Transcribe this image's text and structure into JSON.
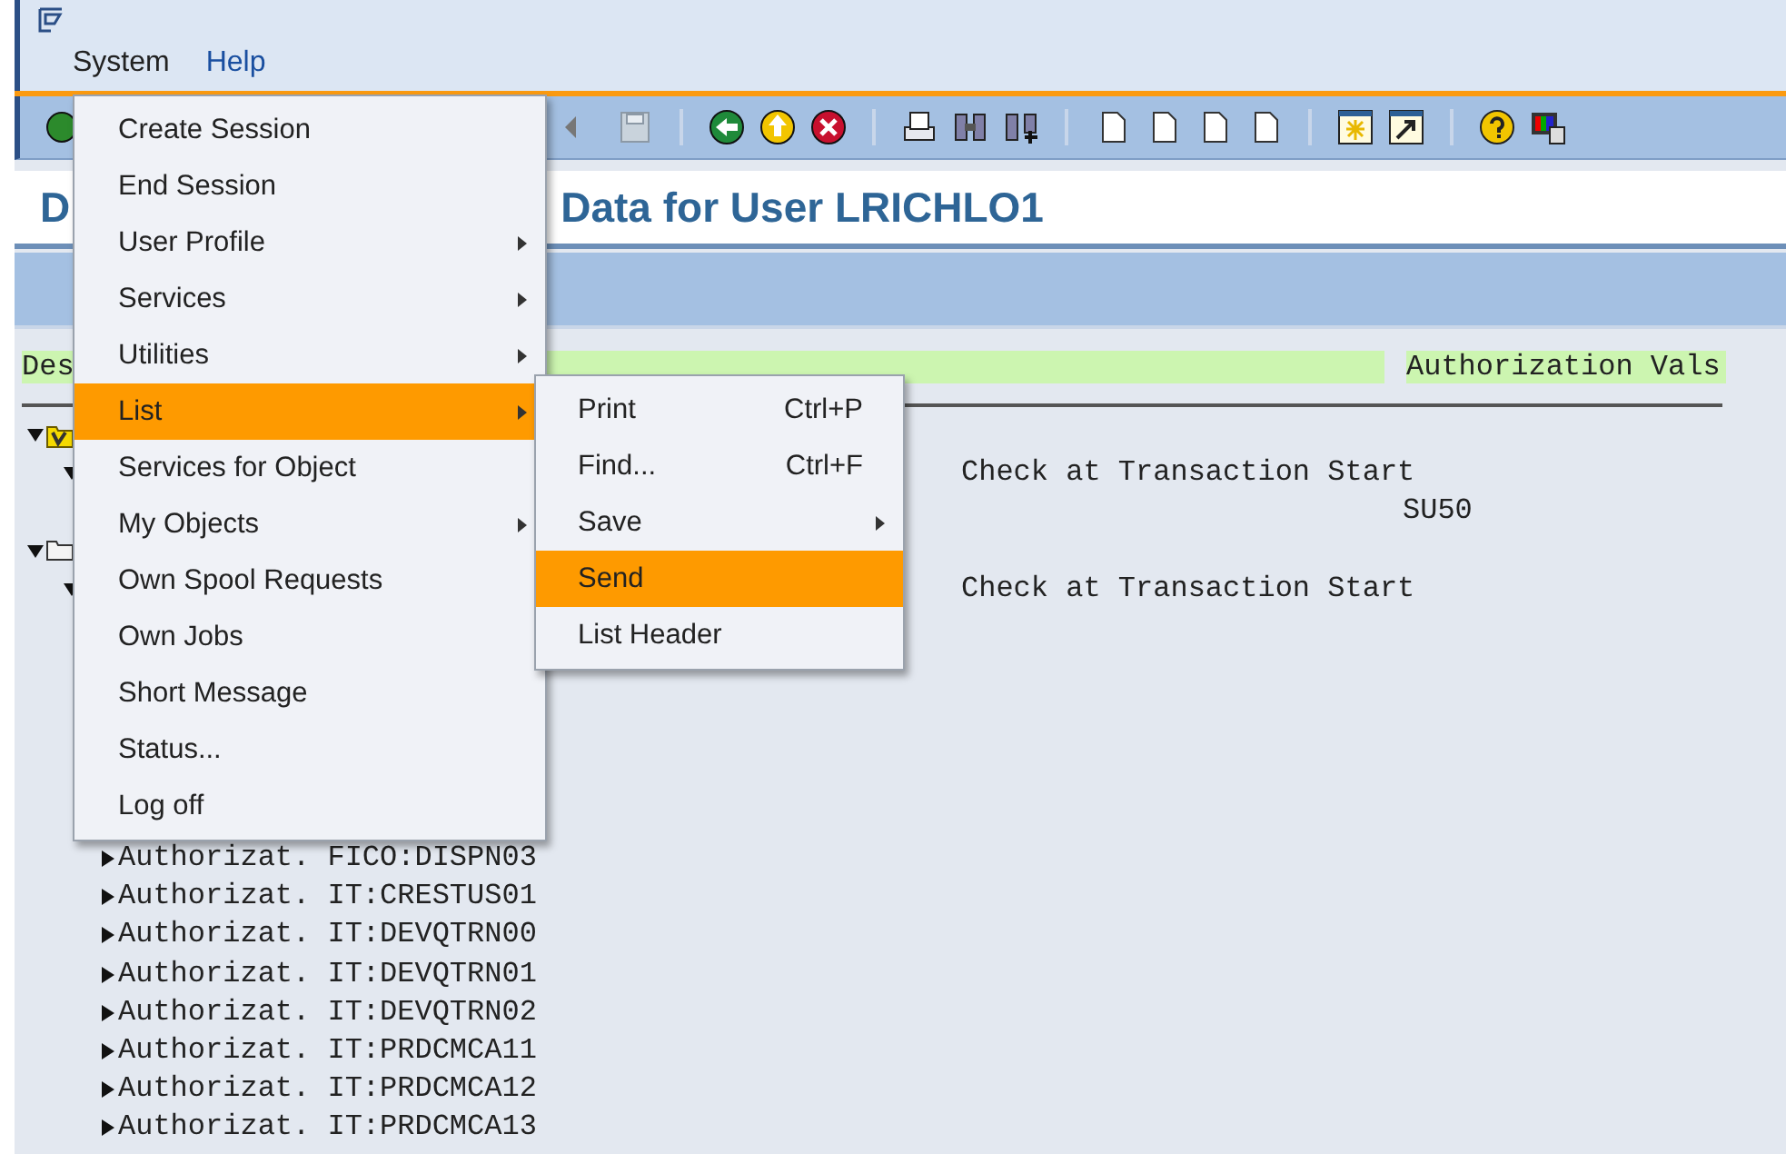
{
  "menubar": [
    {
      "label": "System",
      "selected": true
    },
    {
      "label": "Help",
      "selected": false
    }
  ],
  "page_title": {
    "start": "D",
    "end": "Data for User LRICHLO1"
  },
  "list_header": [
    "Des",
    "Authorization Vals"
  ],
  "tree": [
    {
      "kind": "role",
      "expanded": true,
      "children": [
        {
          "kind": "node",
          "expanded": true,
          "value": "Check at Transaction Start",
          "children": [
            {
              "kind": "field",
              "value": "SU50"
            }
          ]
        }
      ]
    },
    {
      "kind": "folder",
      "expanded": true,
      "children": [
        {
          "kind": "node",
          "expanded": true,
          "value": "Check at Transaction Start",
          "children": [
            {
              "kind": "auth",
              "expanded": false,
              "label": "Authorizat. FICO:DISPN03"
            },
            {
              "kind": "auth",
              "expanded": false,
              "label": "Authorizat. IT:CRESTUS01"
            },
            {
              "kind": "auth",
              "expanded": false,
              "label": "Authorizat. IT:DEVQTRN00"
            },
            {
              "kind": "auth",
              "expanded": false,
              "label": "Authorizat. IT:DEVQTRN01"
            },
            {
              "kind": "auth",
              "expanded": false,
              "label": "Authorizat. IT:DEVQTRN02"
            },
            {
              "kind": "auth",
              "expanded": false,
              "label": "Authorizat. IT:PRDCMCA11"
            },
            {
              "kind": "auth",
              "expanded": false,
              "label": "Authorizat. IT:PRDCMCA12"
            },
            {
              "kind": "auth",
              "expanded": false,
              "label": "Authorizat. IT:PRDCMCA13"
            }
          ]
        }
      ]
    }
  ],
  "system_menu": [
    {
      "label": "Create Session",
      "submenu": false,
      "selected": false
    },
    {
      "label": "End Session",
      "submenu": false,
      "selected": false
    },
    {
      "label": "User Profile",
      "submenu": true,
      "selected": false
    },
    {
      "label": "Services",
      "submenu": true,
      "selected": false
    },
    {
      "label": "Utilities",
      "submenu": true,
      "selected": false
    },
    {
      "label": "List",
      "submenu": true,
      "selected": true
    },
    {
      "label": "Services for Object",
      "submenu": false,
      "selected": false
    },
    {
      "label": "My Objects",
      "submenu": true,
      "selected": false
    },
    {
      "label": "Own Spool Requests",
      "submenu": false,
      "selected": false
    },
    {
      "label": "Own Jobs",
      "submenu": false,
      "selected": false
    },
    {
      "label": "Short Message",
      "submenu": false,
      "selected": false
    },
    {
      "label": "Status...",
      "submenu": false,
      "selected": false
    },
    {
      "label": "Log off",
      "submenu": false,
      "selected": false
    }
  ],
  "list_menu": [
    {
      "label": "Print",
      "shortcut": "Ctrl+P",
      "submenu": false,
      "selected": false
    },
    {
      "label": "Find...",
      "shortcut": "Ctrl+F",
      "submenu": false,
      "selected": false
    },
    {
      "label": "Save",
      "submenu": true,
      "selected": false
    },
    {
      "label": "Send",
      "submenu": false,
      "selected": true
    },
    {
      "label": "List Header",
      "submenu": false,
      "selected": false
    }
  ]
}
